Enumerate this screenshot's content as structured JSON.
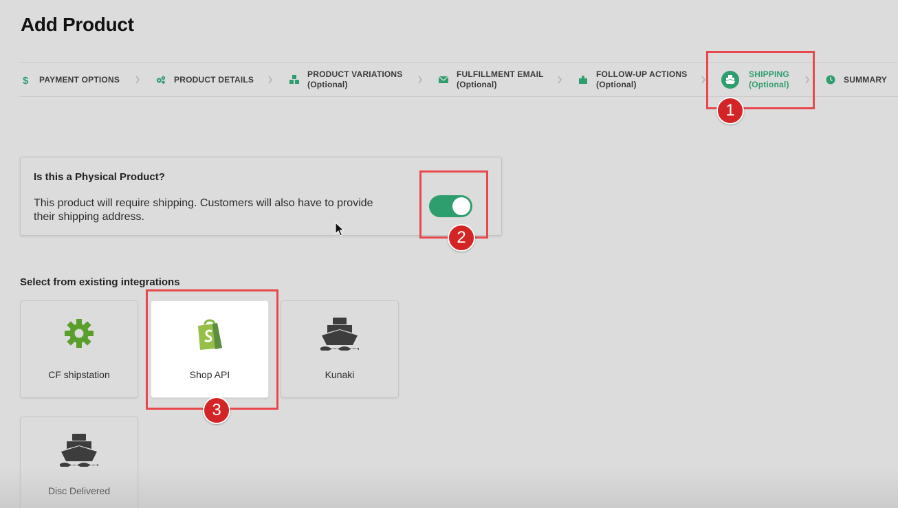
{
  "page": {
    "title": "Add Product"
  },
  "colors": {
    "accent": "#2f9e6e",
    "highlight": "#e8484c",
    "badge": "#d42526"
  },
  "steps": [
    {
      "label": "PAYMENT OPTIONS",
      "sub": "",
      "icon": "dollar-icon"
    },
    {
      "label": "PRODUCT DETAILS",
      "sub": "",
      "icon": "gears-icon"
    },
    {
      "label": "PRODUCT VARIATIONS",
      "sub": "(Optional)",
      "icon": "cubes-icon"
    },
    {
      "label": "FULFILLMENT EMAIL",
      "sub": "(Optional)",
      "icon": "envelope-icon"
    },
    {
      "label": "FOLLOW-UP ACTIONS",
      "sub": "(Optional)",
      "icon": "puzzle-icon"
    },
    {
      "label": "SHIPPING",
      "sub": "(Optional)",
      "icon": "ship-icon",
      "active": true
    },
    {
      "label": "SUMMARY",
      "sub": "",
      "icon": "clock-icon"
    }
  ],
  "physical": {
    "title": "Is this a Physical Product?",
    "description": "This product will require shipping. Customers will also have to provide their shipping address.",
    "toggle_on": true
  },
  "integrations": {
    "label": "Select from existing integrations",
    "items": [
      {
        "label": "CF shipstation",
        "icon": "gear-icon"
      },
      {
        "label": "Shop API",
        "icon": "shopify-bag-icon",
        "selected": true
      },
      {
        "label": "Kunaki",
        "icon": "ship-icon"
      },
      {
        "label": "Disc Delivered",
        "icon": "ship-icon"
      }
    ]
  },
  "annotations": {
    "one": "1",
    "two": "2",
    "three": "3"
  }
}
